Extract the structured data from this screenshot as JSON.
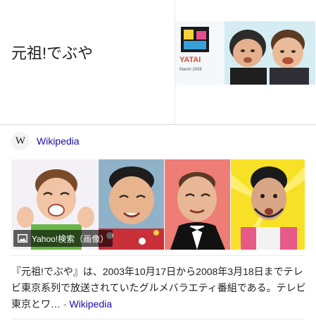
{
  "header": {
    "title": "元祖!でぶや"
  },
  "thumbnail": {
    "logo_text": "YATAI",
    "logo_sub": "March 2008"
  },
  "source": {
    "icon": "wikipedia-w-icon",
    "label": "Wikipedia"
  },
  "gallery": {
    "badge_label": "Yahoo!検索（画像）",
    "badge_icon": "image-icon",
    "images": [
      {
        "name": "laughing-man-photo"
      },
      {
        "name": "smiling-man-photo"
      },
      {
        "name": "man-in-tuxedo-photo"
      },
      {
        "name": "bearded-man-photo"
      }
    ]
  },
  "description": {
    "text": "『元祖!でぶや』は、2003年10月17日から2008年3月18日までテレビ東京系列で放送されていたグルメバラエティ番組である。テレビ東京とワ…",
    "separator": " - ",
    "source_link": "Wikipedia"
  },
  "colors": {
    "link": "#1a0dab",
    "text": "#202124",
    "border": "#dadce0"
  }
}
